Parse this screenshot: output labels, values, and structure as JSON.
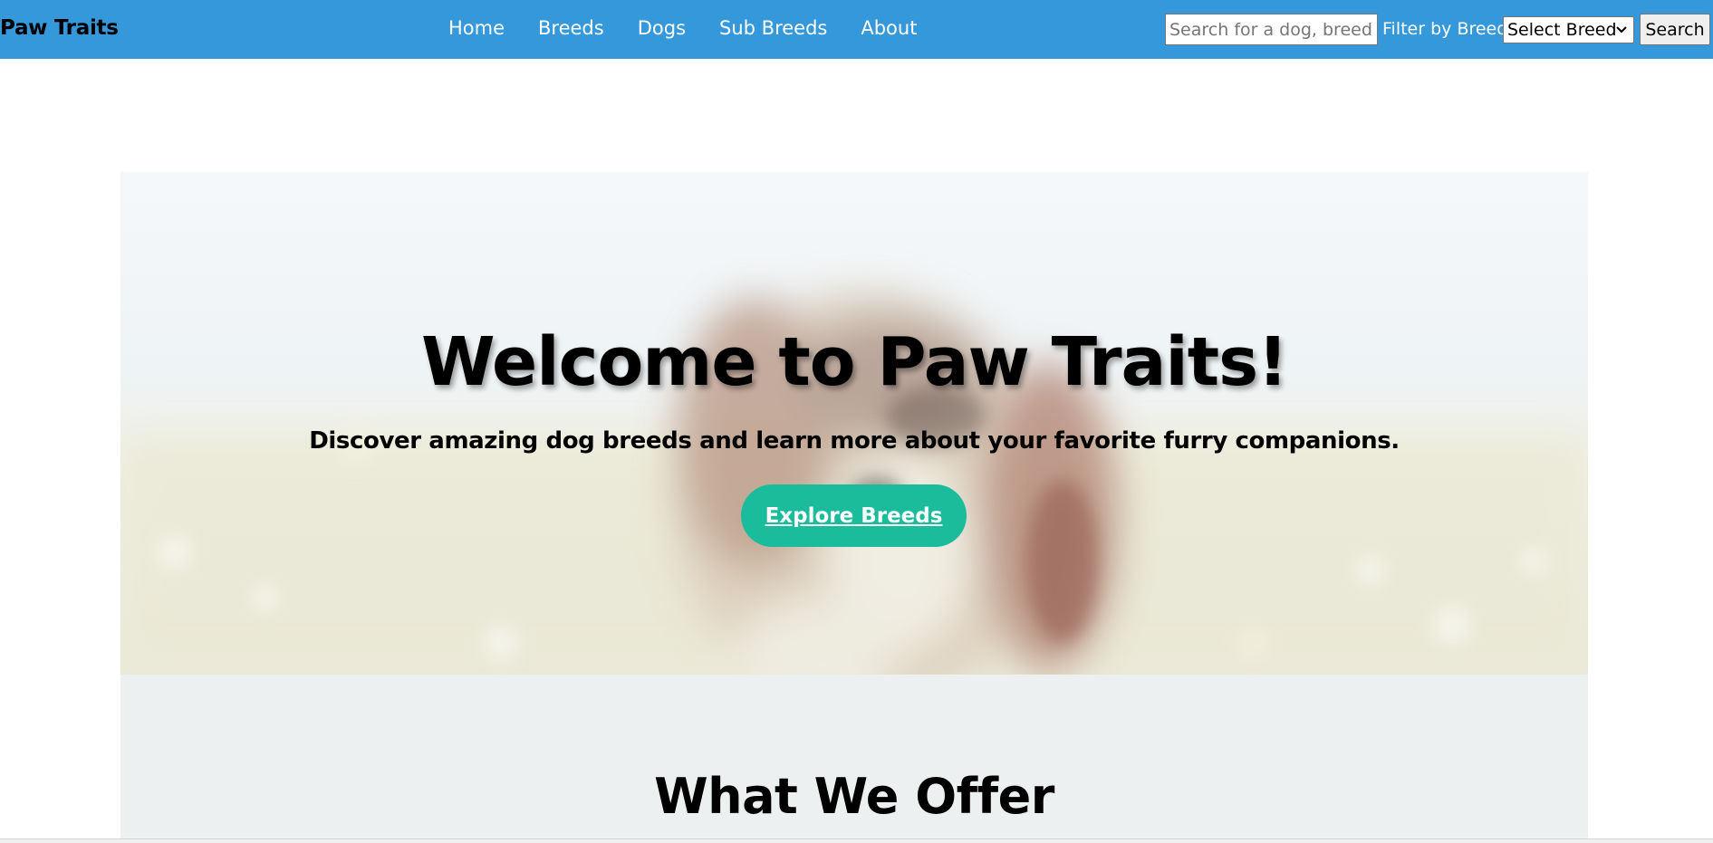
{
  "navbar": {
    "brand": "Paw Traits",
    "links": [
      "Home",
      "Breeds",
      "Dogs",
      "Sub Breeds",
      "About"
    ],
    "search": {
      "placeholder": "Search for a dog, breed, or sub breed",
      "value": ""
    },
    "filter_label": "Filter by Breed",
    "filter_selected": "Select Breed",
    "search_button": "Search"
  },
  "hero": {
    "title": "Welcome to Paw Traits!",
    "subtitle": "Discover amazing dog breeds and learn more about your favorite furry companions.",
    "cta": "Explore Breeds",
    "image": "dog-in-flower-field-photo"
  },
  "offer": {
    "title": "What We Offer"
  },
  "colors": {
    "navbar": "#3498db",
    "cta": "#1abc9c",
    "offer_bg": "#ecf0f1"
  }
}
